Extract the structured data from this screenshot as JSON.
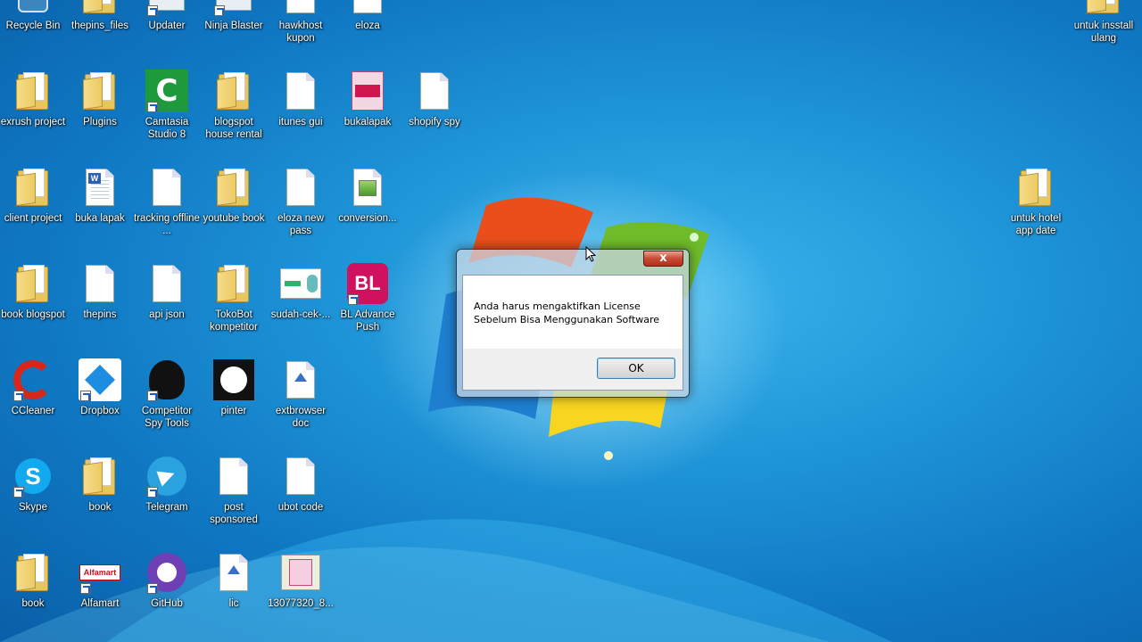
{
  "desktop": {
    "icons": [
      {
        "id": "recycle-bin",
        "label": "Recycle Bin",
        "type": "recycle",
        "col": 0,
        "row": -1
      },
      {
        "id": "thepins-files",
        "label": "thepins_files",
        "type": "folder",
        "col": 1,
        "row": -1
      },
      {
        "id": "updater",
        "label": "Updater",
        "type": "app",
        "col": 2,
        "row": -1,
        "shortcut": true
      },
      {
        "id": "ninja-blaster",
        "label": "Ninja Blaster",
        "type": "app",
        "col": 3,
        "row": -1,
        "shortcut": true
      },
      {
        "id": "hawkhost-kupon",
        "label": "hawkhost kupon",
        "type": "doc",
        "col": 4,
        "row": -1
      },
      {
        "id": "eloza",
        "label": "eloza",
        "type": "doc",
        "col": 5,
        "row": -1
      },
      {
        "id": "untuk-insstall-ulang",
        "label": "untuk insstall ulang",
        "type": "folder",
        "col": "r1",
        "row": -1
      },
      {
        "id": "exrush-project",
        "label": "exrush project",
        "type": "folder",
        "col": 0,
        "row": 0
      },
      {
        "id": "plugins",
        "label": "Plugins",
        "type": "folder",
        "col": 1,
        "row": 0
      },
      {
        "id": "camtasia",
        "label": "Camtasia Studio 8",
        "type": "camtasia",
        "col": 2,
        "row": 0,
        "shortcut": true
      },
      {
        "id": "blogspot-house-rental",
        "label": "blogspot house rental",
        "type": "folder",
        "col": 3,
        "row": 0
      },
      {
        "id": "itunes-gui",
        "label": "itunes gui",
        "type": "doc",
        "col": 4,
        "row": 0
      },
      {
        "id": "bukalapak",
        "label": "bukalapak",
        "type": "pink",
        "col": 5,
        "row": 0
      },
      {
        "id": "shopify-spy",
        "label": "shopify spy",
        "type": "doc",
        "col": 6,
        "row": 0
      },
      {
        "id": "client-project",
        "label": "client project",
        "type": "folder",
        "col": 0,
        "row": 1
      },
      {
        "id": "buka-lapak",
        "label": "buka lapak",
        "type": "word",
        "col": 1,
        "row": 1
      },
      {
        "id": "tracking-offline",
        "label": "tracking offline ...",
        "type": "doc",
        "col": 2,
        "row": 1
      },
      {
        "id": "youtube-book",
        "label": "youtube book",
        "type": "folder",
        "col": 3,
        "row": 1
      },
      {
        "id": "eloza-new-pass",
        "label": "eloza new pass",
        "type": "doc",
        "col": 4,
        "row": 1
      },
      {
        "id": "conversion",
        "label": "conversion...",
        "type": "image",
        "col": 5,
        "row": 1
      },
      {
        "id": "untuk-hotel-app-date",
        "label": "untuk hotel app date",
        "type": "folder",
        "col": "r2",
        "row": 1
      },
      {
        "id": "book-blogspot",
        "label": "book blogspot",
        "type": "folder",
        "col": 0,
        "row": 2
      },
      {
        "id": "thepins",
        "label": "thepins",
        "type": "doc",
        "col": 1,
        "row": 2
      },
      {
        "id": "api-json",
        "label": "api json",
        "type": "doc",
        "col": 2,
        "row": 2
      },
      {
        "id": "tokobot-kompetitor",
        "label": "TokoBot kompetitor",
        "type": "folder",
        "col": 3,
        "row": 2
      },
      {
        "id": "sudah-cek",
        "label": "sudah-cek-...",
        "type": "card",
        "col": 4,
        "row": 2
      },
      {
        "id": "bl-advance-push",
        "label": "BL Advance Push",
        "type": "bl",
        "col": 5,
        "row": 2,
        "shortcut": true
      },
      {
        "id": "ccleaner",
        "label": "CCleaner",
        "type": "ccleaner",
        "col": 0,
        "row": 3,
        "shortcut": true
      },
      {
        "id": "dropbox",
        "label": "Dropbox",
        "type": "dropbox",
        "col": 1,
        "row": 3,
        "shortcut": true
      },
      {
        "id": "competitor-spy-tools",
        "label": "Competitor Spy Tools",
        "type": "spy",
        "col": 2,
        "row": 3,
        "shortcut": true
      },
      {
        "id": "pinter",
        "label": "pinter",
        "type": "pinter",
        "col": 3,
        "row": 3
      },
      {
        "id": "extbrowser-doc",
        "label": "extbrowser doc",
        "type": "pinfile",
        "col": 4,
        "row": 3
      },
      {
        "id": "skype",
        "label": "Skype",
        "type": "skype",
        "col": 0,
        "row": 4,
        "shortcut": true
      },
      {
        "id": "book-4",
        "label": "book",
        "type": "folder",
        "col": 1,
        "row": 4
      },
      {
        "id": "telegram",
        "label": "Telegram",
        "type": "telegram",
        "col": 2,
        "row": 4,
        "shortcut": true
      },
      {
        "id": "post-sponsored",
        "label": "post sponsored",
        "type": "doc",
        "col": 3,
        "row": 4
      },
      {
        "id": "ubot-code",
        "label": "ubot code",
        "type": "doc",
        "col": 4,
        "row": 4
      },
      {
        "id": "book-5",
        "label": "book",
        "type": "folder",
        "col": 0,
        "row": 5
      },
      {
        "id": "alfamart",
        "label": "Alfamart",
        "type": "alfamart",
        "col": 1,
        "row": 5,
        "shortcut": true
      },
      {
        "id": "github",
        "label": "GitHub",
        "type": "github",
        "col": 2,
        "row": 5,
        "shortcut": true
      },
      {
        "id": "lic",
        "label": "lic",
        "type": "pinfile",
        "col": 3,
        "row": 5
      },
      {
        "id": "file-13077320",
        "label": "13077320_8...",
        "type": "pinkimg",
        "col": 4,
        "row": 5
      }
    ]
  },
  "dialog": {
    "message_line1": "Anda harus mengaktifkan License",
    "message_line2": "Sebelum Bisa Menggunakan Software",
    "ok_label": "OK",
    "close_glyph": "x"
  },
  "colors": {
    "accent": "#1a5fc8",
    "desktop": "#1f95d8"
  }
}
